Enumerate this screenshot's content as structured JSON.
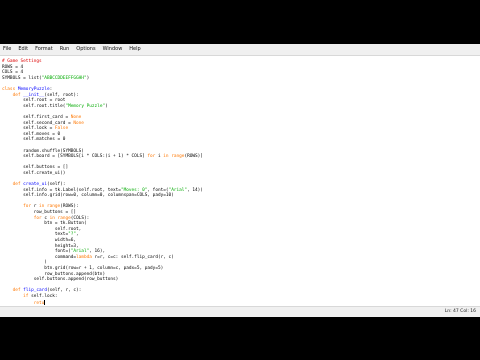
{
  "menubar": {
    "items": [
      "File",
      "Edit",
      "Format",
      "Run",
      "Options",
      "Window",
      "Help"
    ]
  },
  "editor": {
    "lines": [
      [
        {
          "t": "# Game Settings",
          "c": "cmt"
        }
      ],
      [
        {
          "t": "ROWS = 4"
        }
      ],
      [
        {
          "t": "COLS = 4"
        }
      ],
      [
        {
          "t": "SYMBOLS = list("
        },
        {
          "t": "\"ABBCCDDEEFFGGHH\"",
          "c": "str"
        },
        {
          "t": ")"
        }
      ],
      [
        {
          "t": ""
        }
      ],
      [
        {
          "t": "class",
          "c": "kw"
        },
        {
          "t": " "
        },
        {
          "t": "MemoryPuzzle",
          "c": "def"
        },
        {
          "t": ":"
        }
      ],
      [
        {
          "t": "    "
        },
        {
          "t": "def",
          "c": "kw"
        },
        {
          "t": " "
        },
        {
          "t": "__init__",
          "c": "def"
        },
        {
          "t": "(self, root):"
        }
      ],
      [
        {
          "t": "        self.root = root"
        }
      ],
      [
        {
          "t": "        self.root.title("
        },
        {
          "t": "\"Memory Puzzle\"",
          "c": "str"
        },
        {
          "t": ")"
        }
      ],
      [
        {
          "t": ""
        }
      ],
      [
        {
          "t": "        self.first_card = "
        },
        {
          "t": "None",
          "c": "kw"
        }
      ],
      [
        {
          "t": "        self.second_card = "
        },
        {
          "t": "None",
          "c": "kw"
        }
      ],
      [
        {
          "t": "        self.lock = "
        },
        {
          "t": "False",
          "c": "kw"
        }
      ],
      [
        {
          "t": "        self.moves = 0"
        }
      ],
      [
        {
          "t": "        self.matches = 0"
        }
      ],
      [
        {
          "t": ""
        }
      ],
      [
        {
          "t": "        random.shuffle(SYMBOLS)"
        }
      ],
      [
        {
          "t": "        self.board = [SYMBOLS[i * COLS:(i + 1) * COLS] "
        },
        {
          "t": "for",
          "c": "kw"
        },
        {
          "t": " i "
        },
        {
          "t": "in",
          "c": "kw"
        },
        {
          "t": " "
        },
        {
          "t": "range",
          "c": "kw"
        },
        {
          "t": "(ROWS)]"
        }
      ],
      [
        {
          "t": ""
        }
      ],
      [
        {
          "t": "        self.buttons = []"
        }
      ],
      [
        {
          "t": "        self.create_ui()"
        }
      ],
      [
        {
          "t": ""
        }
      ],
      [
        {
          "t": "    "
        },
        {
          "t": "def",
          "c": "kw"
        },
        {
          "t": " "
        },
        {
          "t": "create_ui",
          "c": "def"
        },
        {
          "t": "(self):"
        }
      ],
      [
        {
          "t": "        self.info = tk.Label(self.root, text="
        },
        {
          "t": "\"Moves: 0\"",
          "c": "str"
        },
        {
          "t": ", font=("
        },
        {
          "t": "\"Arial\"",
          "c": "str"
        },
        {
          "t": ", 14))"
        }
      ],
      [
        {
          "t": "        self.info.grid(row=0, column=0, columnspan=COLS, pady=10)"
        }
      ],
      [
        {
          "t": ""
        }
      ],
      [
        {
          "t": "        "
        },
        {
          "t": "for",
          "c": "kw"
        },
        {
          "t": " r "
        },
        {
          "t": "in",
          "c": "kw"
        },
        {
          "t": " "
        },
        {
          "t": "range",
          "c": "kw"
        },
        {
          "t": "(ROWS):"
        }
      ],
      [
        {
          "t": "            row_buttons = []"
        }
      ],
      [
        {
          "t": "            "
        },
        {
          "t": "for",
          "c": "kw"
        },
        {
          "t": " c "
        },
        {
          "t": "in",
          "c": "kw"
        },
        {
          "t": " "
        },
        {
          "t": "range",
          "c": "kw"
        },
        {
          "t": "(COLS):"
        }
      ],
      [
        {
          "t": "                btn = tk.Button("
        }
      ],
      [
        {
          "t": "                    self.root,"
        }
      ],
      [
        {
          "t": "                    text="
        },
        {
          "t": "\"?\"",
          "c": "str"
        },
        {
          "t": ","
        }
      ],
      [
        {
          "t": "                    width=6,"
        }
      ],
      [
        {
          "t": "                    height=3,"
        }
      ],
      [
        {
          "t": "                    font=("
        },
        {
          "t": "\"Arial\"",
          "c": "str"
        },
        {
          "t": ", 16),"
        }
      ],
      [
        {
          "t": "                    command="
        },
        {
          "t": "lambda",
          "c": "kw"
        },
        {
          "t": " r=r, c=c: self.flip_card(r, c)"
        }
      ],
      [
        {
          "t": "                )"
        }
      ],
      [
        {
          "t": "                btn.grid(row=r + 1, column=c, padx=5, pady=5)"
        }
      ],
      [
        {
          "t": "                row_buttons.append(btn)"
        }
      ],
      [
        {
          "t": "            self.buttons.append(row_buttons)"
        }
      ],
      [
        {
          "t": ""
        }
      ],
      [
        {
          "t": "    "
        },
        {
          "t": "def",
          "c": "kw"
        },
        {
          "t": " "
        },
        {
          "t": "flip_card",
          "c": "def"
        },
        {
          "t": "(self, r, c):"
        }
      ],
      [
        {
          "t": "        "
        },
        {
          "t": "if",
          "c": "kw"
        },
        {
          "t": " self.lock:"
        }
      ],
      [
        {
          "t": "            "
        },
        {
          "t": "retu",
          "c": "kw"
        }
      ]
    ]
  },
  "statusbar": {
    "position": "Ln: 47  Col: 16"
  }
}
